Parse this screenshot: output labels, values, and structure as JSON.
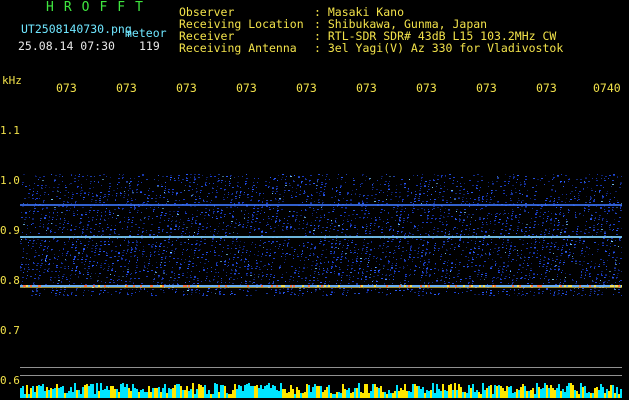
{
  "brand": "HROFFT",
  "file": {
    "name": "UT2508140730.png",
    "tag": "meteor",
    "datetime": "25.08.14 07:30",
    "count": "119"
  },
  "header": [
    {
      "label": "Observer",
      "value": ": Masaki Kano"
    },
    {
      "label": "Receiving Location",
      "value": ": Shibukawa, Gunma, Japan"
    },
    {
      "label": "Receiver",
      "value": ": RTL-SDR SDR# 43dB L15 103.2MHz CW"
    },
    {
      "label": "Receiving Antenna",
      "value": ": 3el Yagi(V) Az 330 for Vladivostok"
    }
  ],
  "time_ticks": [
    "073",
    "073",
    "073",
    "073",
    "073",
    "073",
    "073",
    "073",
    "073",
    "0740"
  ],
  "y_axis": {
    "unit": "kHz",
    "ticks": [
      "1.1",
      "1.0",
      "0.9",
      "0.8",
      "0.7",
      "0.6"
    ]
  },
  "colors": {
    "label": "#f2e24a",
    "brand": "#3fe63f",
    "file": "#6fe6ff",
    "noise": "#1a3fd8",
    "band": "#7fd3ff",
    "hot": "#ffe24a",
    "baseline_cyan": "#00e5ff",
    "baseline_yellow": "#ffe600"
  }
}
